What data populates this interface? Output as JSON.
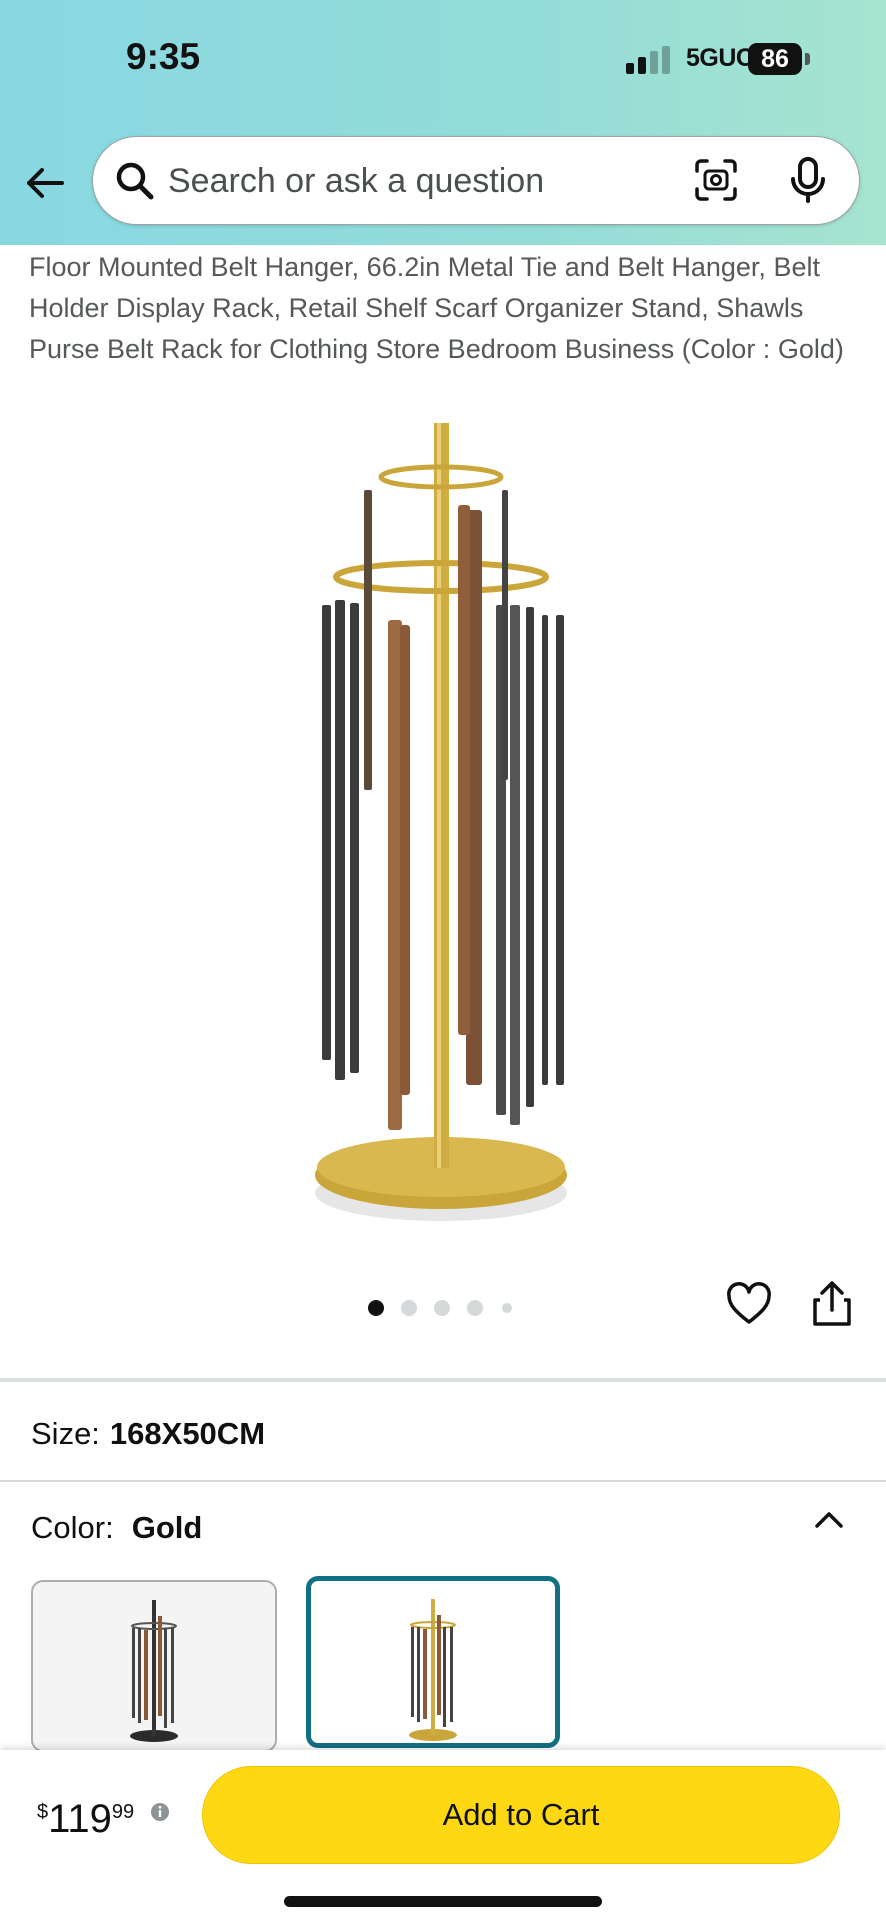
{
  "status_bar": {
    "time": "9:35",
    "network": "5GUC",
    "battery": "86"
  },
  "search": {
    "placeholder": "Search or ask a question"
  },
  "product": {
    "title": "Floor Mounted Belt Hanger, 66.2in Metal Tie and Belt Hanger, Belt Holder Display Rack, Retail Shelf Scarf Organizer Stand, Shawls Purse Belt Rack for Clothing Store Bedroom Business (Color : Gold)",
    "image_icon": "gold-belt-rack-image",
    "carousel": {
      "count": 5,
      "active_index": 0
    }
  },
  "size": {
    "label": "Size:",
    "value": "168X50CM"
  },
  "color": {
    "label": "Color:",
    "value": "Gold",
    "options": [
      {
        "name": "Black",
        "selected": false
      },
      {
        "name": "Gold",
        "selected": true
      }
    ]
  },
  "price": {
    "symbol": "$",
    "whole": "119",
    "fraction": "99"
  },
  "actions": {
    "add_to_cart": "Add to Cart"
  },
  "colors": {
    "header_gradient_start": "#88d8e2",
    "header_gradient_end": "#a6e4cf",
    "add_to_cart": "#ffd814",
    "selected_swatch_border": "#127083",
    "gold": "#c9a53a"
  }
}
